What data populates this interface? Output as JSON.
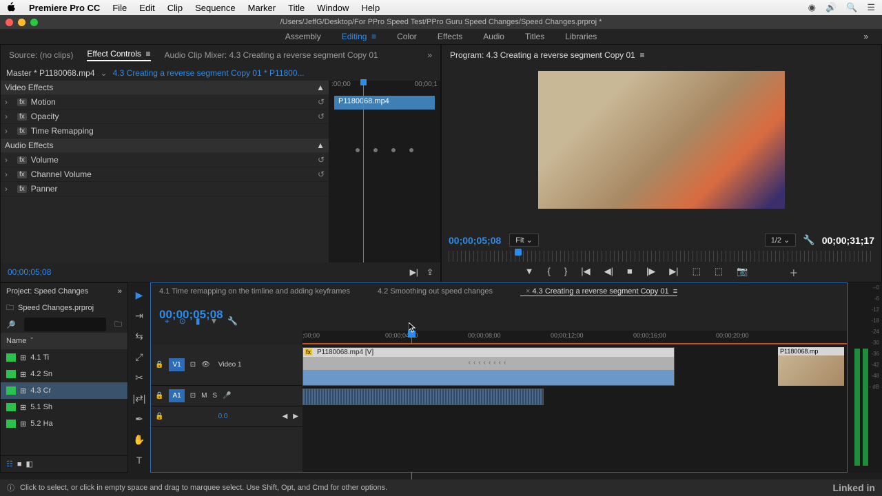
{
  "mac_menu": {
    "app": "Premiere Pro CC",
    "items": [
      "File",
      "Edit",
      "Clip",
      "Sequence",
      "Marker",
      "Title",
      "Window",
      "Help"
    ]
  },
  "window_title": "/Users/JeffG/Desktop/For PPro Speed Test/PPro Guru Speed Changes/Speed Changes.prproj *",
  "workspaces": {
    "items": [
      "Assembly",
      "Editing",
      "Color",
      "Effects",
      "Audio",
      "Titles",
      "Libraries"
    ],
    "active": "Editing"
  },
  "source_tabs": {
    "source": "Source: (no clips)",
    "ec": "Effect Controls",
    "mixer": "Audio Clip Mixer: 4.3 Creating a reverse segment Copy 01"
  },
  "ec": {
    "master": "Master * P1180068.mp4",
    "link": "4.3 Creating a reverse segment Copy 01 * P11800...",
    "clip_label": "P1180068.mp4",
    "ruler": {
      "start": ":00;00",
      "end": "00;00;1"
    },
    "video_hdr": "Video Effects",
    "audio_hdr": "Audio Effects",
    "video_fx": [
      "Motion",
      "Opacity",
      "Time Remapping"
    ],
    "audio_fx": [
      "Volume",
      "Channel Volume",
      "Panner"
    ],
    "foot_tc": "00;00;05;08"
  },
  "program": {
    "title": "Program: 4.3 Creating a reverse segment Copy 01",
    "tc": "00;00;05;08",
    "fit": "Fit",
    "res": "1/2",
    "dur": "00;00;31;17"
  },
  "project": {
    "title": "Project: Speed Changes",
    "file": "Speed Changes.prproj",
    "col": "Name",
    "items": [
      "4.1 Ti",
      "4.2 Sn",
      "4.3 Cr",
      "5.1 Sh",
      "5.2 Ha"
    ],
    "selected": "4.3 Cr"
  },
  "timeline": {
    "tabs": [
      "4.1 Time remapping on the timline and adding keyframes",
      "4.2 Smoothing out speed changes",
      "4.3 Creating a reverse segment Copy 01"
    ],
    "active_tab": "4.3 Creating a reverse segment Copy 01",
    "tc": "00;00;05;08",
    "ruler": [
      ";00;00",
      "00;00;04;00",
      "00;00;08;00",
      "00;00;12;00",
      "00;00;16;00",
      "00;00;20;00"
    ],
    "playhead_pct": 22,
    "v1": "V1",
    "v1_name": "Video 1",
    "a1": "A1",
    "vclip_label": "P1180068.mp4 [V]",
    "thumb_label": "P1180068.mp",
    "pan": "0.0",
    "track_btns": {
      "m": "M",
      "s": "S"
    }
  },
  "meters_scale": [
    "--0",
    "-6",
    "-12",
    "-18",
    "-24",
    "-30",
    "-36",
    "-42",
    "-48",
    "- dB"
  ],
  "status": "Click to select, or click in empty space and drag to marquee select. Use Shift, Opt, and Cmd for other options.",
  "linkedin": "Linked"
}
